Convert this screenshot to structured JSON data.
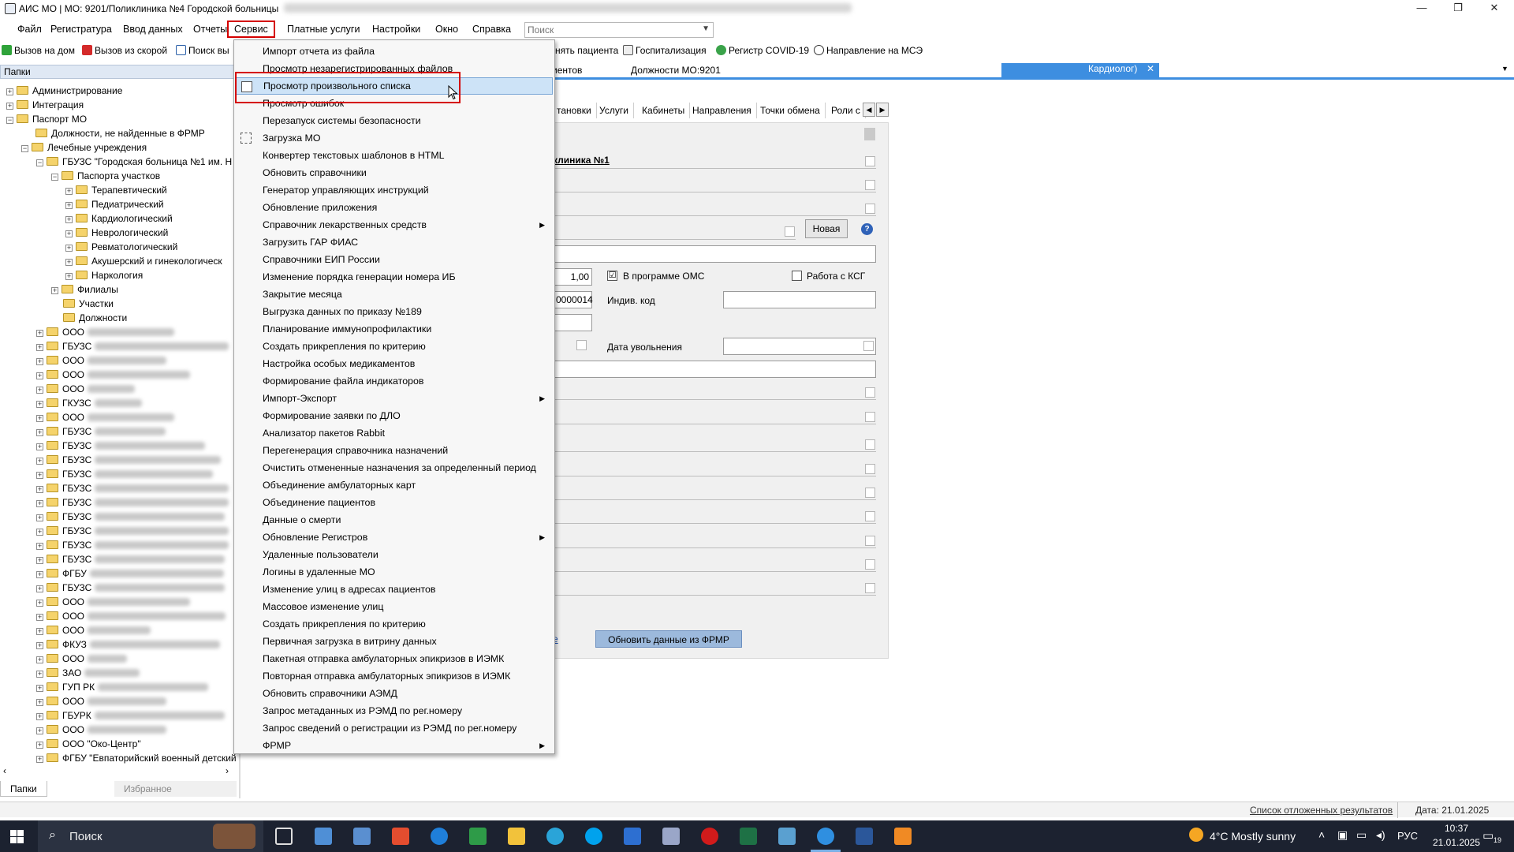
{
  "window": {
    "title": "АИС МО | МО: 9201/Поликлиника №4 Городской больницы",
    "controls": {
      "minimize": "—",
      "restore": "❐",
      "close": "✕"
    }
  },
  "menubar": {
    "items": [
      "Файл",
      "Регистратура",
      "Ввод данных",
      "Отчеты",
      "Сервис",
      "Платные услуги",
      "Настройки",
      "Окно",
      "Справка"
    ],
    "active": "Сервис",
    "search_placeholder": "Поиск"
  },
  "toolbar": {
    "buttons": [
      "Вызов на дом",
      "Вызов из скорой",
      "Поиск вы",
      "нять пациента",
      "Госпитализация",
      "Регистр COVID-19",
      "Направление на МСЭ"
    ]
  },
  "left_panel": {
    "header": "Папки",
    "tree": [
      {
        "label": "Администрирование"
      },
      {
        "label": "Интеграция"
      },
      {
        "label": "Паспорт МО"
      },
      {
        "label": "Должности, не найденные в ФРМР"
      },
      {
        "label": "Лечебные учреждения"
      },
      {
        "label": "ГБУЗС \"Городская больница №1 им. Н"
      },
      {
        "label": "Паспорта участков"
      },
      {
        "label": "Терапевтический"
      },
      {
        "label": "Педиатрический"
      },
      {
        "label": "Кардиологический"
      },
      {
        "label": "Неврологический"
      },
      {
        "label": "Ревматологический"
      },
      {
        "label": "Акушерский и гинекологическ"
      },
      {
        "label": "Наркология"
      },
      {
        "label": "Филиалы"
      },
      {
        "label": "Участки"
      },
      {
        "label": "Должности"
      },
      {
        "label": "ООО"
      },
      {
        "label": "ГБУЗС"
      },
      {
        "label": "ООО"
      },
      {
        "label": "ООО"
      },
      {
        "label": "ООО"
      },
      {
        "label": "ГКУЗС"
      },
      {
        "label": "ООО"
      },
      {
        "label": "ГБУЗС"
      },
      {
        "label": "ГБУЗС"
      },
      {
        "label": "ГБУЗС"
      },
      {
        "label": "ГБУЗС"
      },
      {
        "label": "ГБУЗС"
      },
      {
        "label": "ГБУЗС"
      },
      {
        "label": "ГБУЗС"
      },
      {
        "label": "ГБУЗС"
      },
      {
        "label": "ГБУЗС"
      },
      {
        "label": "ГБУЗС"
      },
      {
        "label": "ФГБУ"
      },
      {
        "label": "ГБУЗС"
      },
      {
        "label": "ООО"
      },
      {
        "label": "ООО"
      },
      {
        "label": "ООО"
      },
      {
        "label": "ФКУЗ"
      },
      {
        "label": "ООО"
      },
      {
        "label": "ЗАО"
      },
      {
        "label": "ГУП РК"
      },
      {
        "label": "ООО"
      },
      {
        "label": "ГБУРК"
      },
      {
        "label": "ООО"
      },
      {
        "label": "ООО \"Око-Центр\""
      },
      {
        "label": "ФГБУ \"Евпаторийский военный детский"
      }
    ],
    "bottom_tabs": [
      "Папки",
      "Избранное"
    ]
  },
  "content": {
    "doc_tabs": [
      "иентов",
      "Должности МО:9201",
      "Кардиолог)"
    ],
    "subtabs": [
      "тановки",
      "Услуги",
      "Кабинеты",
      "Направления",
      "Точки обмена",
      "Роли с"
    ],
    "form": {
      "org_name": "клиника №1",
      "new_button": "Новая",
      "rate_value": "1,00",
      "oms_label": "В программе ОМС",
      "oms_checked": "☑",
      "ksg_label": "Работа с КСГ",
      "code_value": "0000014",
      "indiv_code_label": "Индив. код",
      "dismissal_label": "Дата увольнения",
      "link_text": "е",
      "update_button": "Обновить данные из ФРМР"
    }
  },
  "service_menu": {
    "items": [
      {
        "label": "Импорт отчета из файла"
      },
      {
        "label": "Просмотр незарегистрированных файлов"
      },
      {
        "label": "Просмотр произвольного списка",
        "highlight": true
      },
      {
        "label": "Просмотр ошибок"
      },
      {
        "label": "Перезапуск системы безопасности"
      },
      {
        "label": "Загрузка МО"
      },
      {
        "label": "Конвертер текстовых шаблонов в HTML"
      },
      {
        "label": "Обновить справочники"
      },
      {
        "label": "Генератор управляющих инструкций"
      },
      {
        "label": "Обновление приложения"
      },
      {
        "label": "Справочник лекарственных средств",
        "submenu": true
      },
      {
        "label": "Загрузить ГАР ФИАС"
      },
      {
        "label": "Справочники ЕИП России"
      },
      {
        "label": "Изменение порядка генерации номера ИБ"
      },
      {
        "label": "Закрытие месяца"
      },
      {
        "label": "Выгрузка данных по приказу №189"
      },
      {
        "label": "Планирование иммунопрофилактики"
      },
      {
        "label": "Создать прикрепления по критерию"
      },
      {
        "label": "Настройка особых медикаментов"
      },
      {
        "label": "Формирование файла индикаторов"
      },
      {
        "label": "Импорт-Экспорт",
        "submenu": true
      },
      {
        "label": "Формирование заявки по ДЛО"
      },
      {
        "label": "Анализатор пакетов Rabbit"
      },
      {
        "label": "Перегенерация справочника назначений"
      },
      {
        "label": "Очистить отмененные назначения за определенный период"
      },
      {
        "label": "Объединение амбулаторных карт"
      },
      {
        "label": "Объединение пациентов"
      },
      {
        "label": "Данные о смерти"
      },
      {
        "label": "Обновление Регистров",
        "submenu": true
      },
      {
        "label": "Удаленные пользователи"
      },
      {
        "label": "Логины в удаленные МО"
      },
      {
        "label": "Изменение улиц в адресах пациентов"
      },
      {
        "label": "Массовое изменение улиц"
      },
      {
        "label": "Создать прикрепления по критерию"
      },
      {
        "label": "Первичная загрузка в витрину данных"
      },
      {
        "label": "Пакетная отправка амбулаторных эпикризов в ИЭМК"
      },
      {
        "label": "Повторная отправка амбулаторных эпикризов в ИЭМК"
      },
      {
        "label": "Обновить справочники АЭМД"
      },
      {
        "label": "Запрос метаданных из РЭМД по рег.номеру"
      },
      {
        "label": "Запрос сведений о регистрации из РЭМД по рег.номеру"
      },
      {
        "label": "ФРМР",
        "submenu": true
      }
    ]
  },
  "statusbar": {
    "deferred_results": "Список отложенных результатов",
    "date": "Дата: 21.01.2025"
  },
  "taskbar": {
    "search_placeholder": "Поиск",
    "weather": "4°C  Mostly sunny",
    "lang": "РУС",
    "time": "10:37",
    "date": "21.01.2025",
    "notifications": "19"
  },
  "colors": {
    "highlight_red": "#d40000",
    "menu_highlight": "#cde3f7",
    "tab_active": "#3d8ee0",
    "taskbar_bg": "#1c2230"
  }
}
